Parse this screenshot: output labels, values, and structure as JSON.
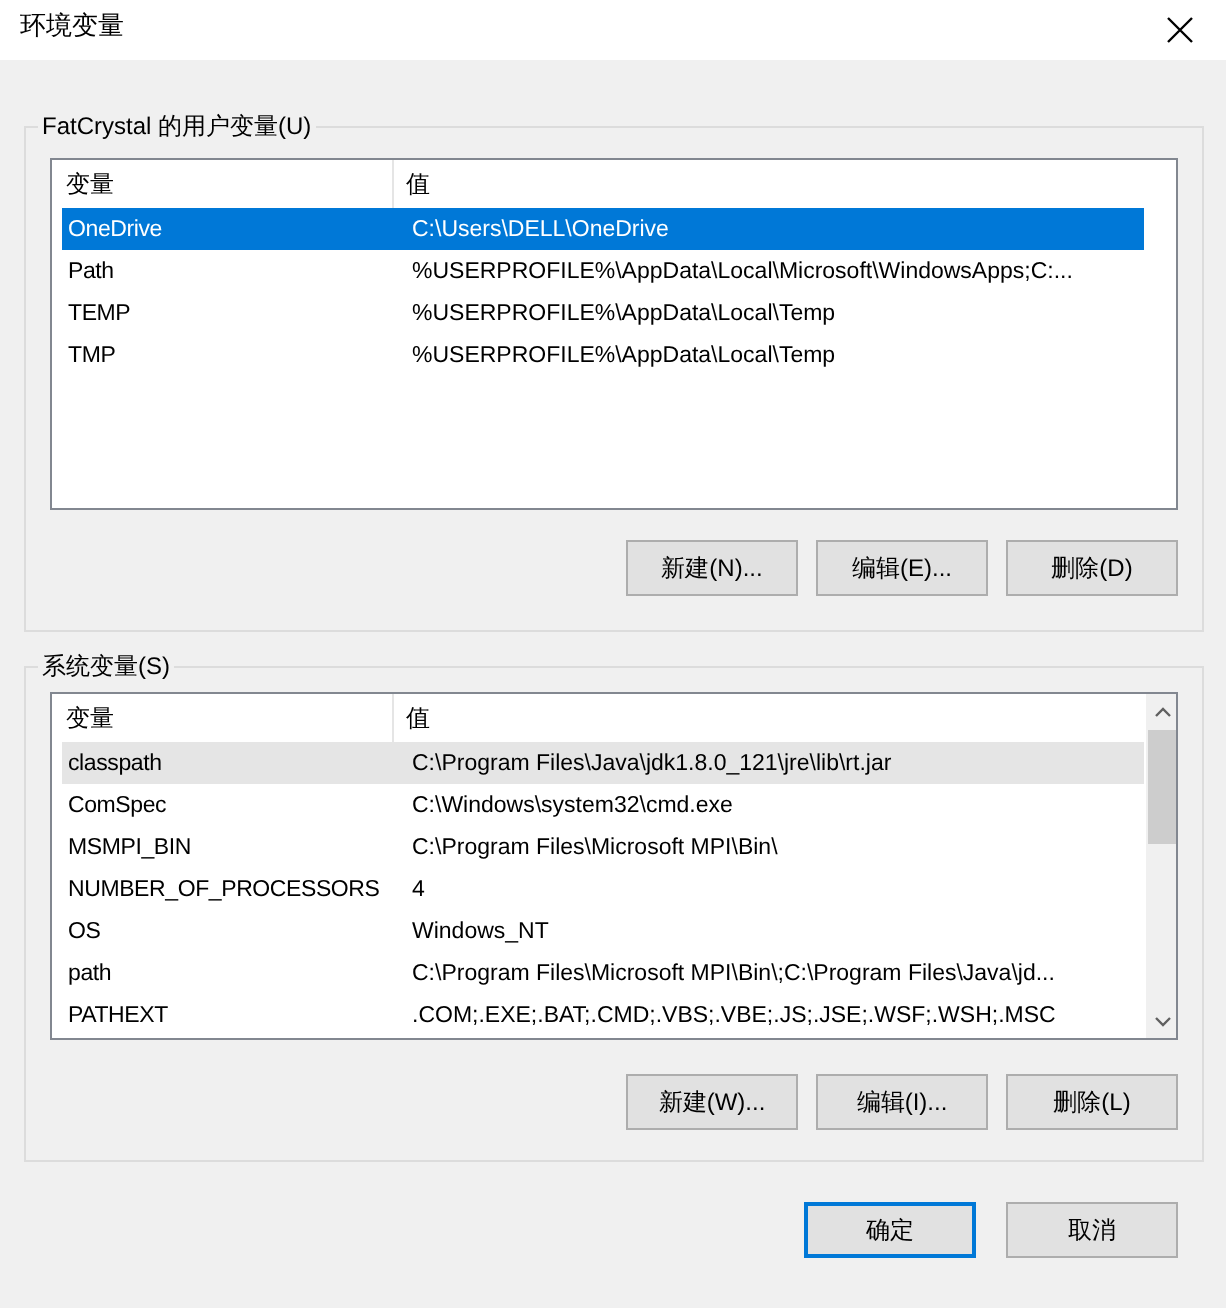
{
  "window": {
    "title": "环境变量"
  },
  "user_variables": {
    "label": "FatCrystal 的用户变量(U)",
    "focused": true,
    "scrollable": false,
    "columns": [
      "变量",
      "值"
    ],
    "rows": [
      {
        "name": "OneDrive",
        "value": "C:\\Users\\DELL\\OneDrive",
        "selected": true
      },
      {
        "name": "Path",
        "value": "%USERPROFILE%\\AppData\\Local\\Microsoft\\WindowsApps;C:...",
        "selected": false
      },
      {
        "name": "TEMP",
        "value": "%USERPROFILE%\\AppData\\Local\\Temp",
        "selected": false
      },
      {
        "name": "TMP",
        "value": "%USERPROFILE%\\AppData\\Local\\Temp",
        "selected": false
      }
    ],
    "buttons": [
      "新建(N)...",
      "编辑(E)...",
      "删除(D)"
    ]
  },
  "system_variables": {
    "label": "系统变量(S)",
    "focused": false,
    "scrollable": true,
    "columns": [
      "变量",
      "值"
    ],
    "rows": [
      {
        "name": "classpath",
        "value": "C:\\Program Files\\Java\\jdk1.8.0_121\\jre\\lib\\rt.jar",
        "selected": true
      },
      {
        "name": "ComSpec",
        "value": "C:\\Windows\\system32\\cmd.exe",
        "selected": false
      },
      {
        "name": "MSMPI_BIN",
        "value": "C:\\Program Files\\Microsoft MPI\\Bin\\",
        "selected": false
      },
      {
        "name": "NUMBER_OF_PROCESSORS",
        "value": "4",
        "selected": false
      },
      {
        "name": "OS",
        "value": "Windows_NT",
        "selected": false
      },
      {
        "name": "path",
        "value": "C:\\Program Files\\Microsoft MPI\\Bin\\;C:\\Program Files\\Java\\jd...",
        "selected": false
      },
      {
        "name": "PATHEXT",
        "value": ".COM;.EXE;.BAT;.CMD;.VBS;.VBE;.JS;.JSE;.WSF;.WSH;.MSC",
        "selected": false
      }
    ],
    "buttons": [
      "新建(W)...",
      "编辑(I)...",
      "删除(L)"
    ]
  },
  "buttons": [
    {
      "label": "确定",
      "default": true
    },
    {
      "label": "取消",
      "default": false
    }
  ]
}
